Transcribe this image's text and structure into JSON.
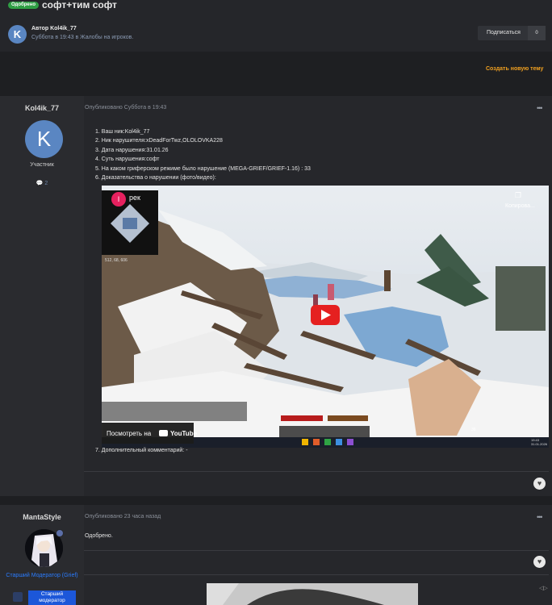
{
  "topic": {
    "badge": "Одобрено",
    "title": "софт+тим софт",
    "author_line": "Автор Kol4ik_77",
    "author_meta": "Суббота в 19:43 в Жалобы на игроков.",
    "author_initial": "K",
    "subscribe_label": "Подписаться",
    "subscribe_count": "0"
  },
  "actions": {
    "new_topic": "Создать новую тему"
  },
  "post1": {
    "username": "Kol4ik_77",
    "avatar_initial": "K",
    "role": "Участник",
    "post_count": "2",
    "published": "Опубликовано Суббота в 19:43",
    "menu": "•••",
    "answers": [
      "1. Ваш ник:Kol4ik_77",
      "2. Ник нарушителя:xDeadForTwz,OLOLOVKA228",
      "3. Дата нарушения:31.01.26",
      "4. Суть нарушения:софт",
      "5. На каком гриферском режиме было нарушение (MEGA-GRIEF/GRIEF-1.16) : 33",
      "6. Доказательства о нарушении (фото/видео):"
    ],
    "extra_comment": "7. Дополнительный комментарий: -",
    "video": {
      "channel_initial": "I",
      "channel_title": "рек",
      "copy_label": "Копирова...",
      "watch_on": "Посмотреть на",
      "youtube": "YouTube",
      "coords": "512, 68, 606",
      "slot_count": "36",
      "tray_time": "19:43",
      "tray_date": "31.01.2026"
    }
  },
  "post2": {
    "username": "MantaStyle",
    "role": "Старший Модератор (Grief)",
    "role_badge": "Старший модератор",
    "published": "Опубликовано 23 часа назад",
    "menu": "•••",
    "text": "Одобрено."
  },
  "colors": {
    "accent_orange": "#f0a020",
    "approved_green": "#2f9e44",
    "moderator_blue": "#2a7cff"
  }
}
